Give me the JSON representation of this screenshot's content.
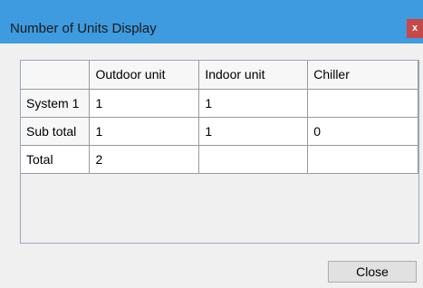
{
  "window": {
    "title": "Number of Units Display",
    "close_glyph": "x"
  },
  "table": {
    "columns": [
      "",
      "Outdoor unit",
      "Indoor unit",
      "Chiller"
    ],
    "rows": [
      {
        "label": "System 1",
        "cells": [
          "1",
          "1",
          ""
        ]
      },
      {
        "label": "Sub total",
        "cells": [
          "1",
          "1",
          "0"
        ]
      },
      {
        "label": "Total",
        "cells": [
          "2",
          "",
          ""
        ]
      }
    ]
  },
  "footer": {
    "close_label": "Close"
  },
  "colors": {
    "titlebar": "#3e9bdf",
    "close_x_bg": "#c74848",
    "panel_border": "#9aa7b8"
  }
}
